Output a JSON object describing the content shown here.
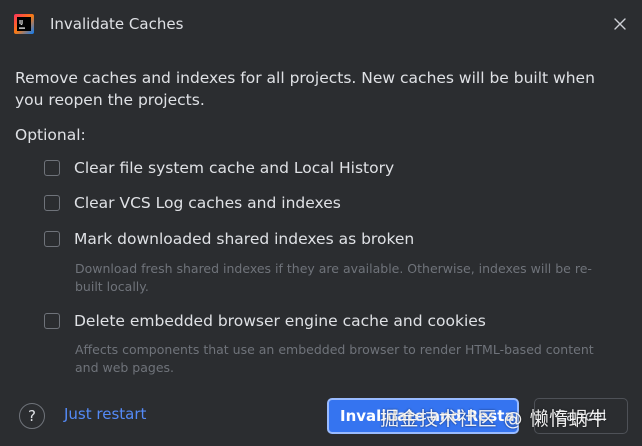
{
  "dialog": {
    "title": "Invalidate Caches",
    "app_icon": "intellij-idea-icon",
    "close_icon": "close-icon"
  },
  "description": "Remove caches and indexes for all projects. New caches will be built when you reopen the projects.",
  "optional_label": "Optional:",
  "options": [
    {
      "label": "Clear file system cache and Local History",
      "checked": false
    },
    {
      "label": "Clear VCS Log caches and indexes",
      "checked": false
    },
    {
      "label": "Mark downloaded shared indexes as broken",
      "checked": false,
      "hint": "Download fresh shared indexes if they are available. Otherwise, indexes will be re-built locally."
    },
    {
      "label": "Delete embedded browser engine cache and cookies",
      "checked": false,
      "hint": "Affects components that use an embedded browser to render HTML-based content and web pages."
    }
  ],
  "footer": {
    "help_glyph": "?",
    "just_restart": "Just restart",
    "primary_button": "Invalidate and Restart",
    "cancel_button": "Cancel"
  },
  "watermark": "掘金技术社区 @ 懒惰蜗牛",
  "colors": {
    "background": "#2b2d30",
    "text": "#dfe1e5",
    "hint": "#6f737a",
    "link": "#548af7",
    "primary": "#3574f0"
  }
}
